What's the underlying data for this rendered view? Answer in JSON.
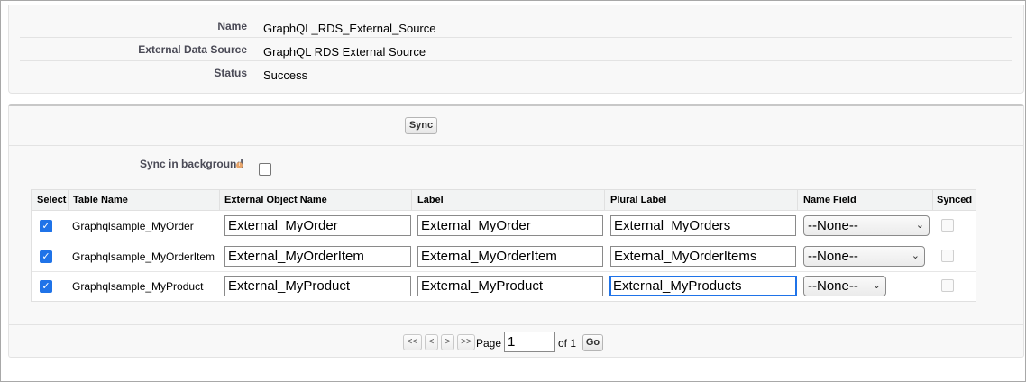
{
  "details": {
    "rows": [
      {
        "label": "Name",
        "value": "GraphQL_RDS_External_Source"
      },
      {
        "label": "External Data Source",
        "value": "GraphQL RDS External Source"
      },
      {
        "label": "Status",
        "value": "Success"
      }
    ]
  },
  "sync": {
    "button_label": "Sync",
    "background_label": "Sync in background",
    "background_checked": false,
    "help_icon": "info-icon"
  },
  "table": {
    "columns": [
      "Select",
      "Table Name",
      "External Object Name",
      "Label",
      "Plural Label",
      "Name Field",
      "Synced"
    ],
    "rows": [
      {
        "selected": true,
        "table_name": "Graphqlsample_MyOrder",
        "external_object_name": "External_MyOrder",
        "label": "External_MyOrder",
        "plural_label": "External_MyOrders",
        "name_field": "--None--",
        "synced": false
      },
      {
        "selected": true,
        "table_name": "Graphqlsample_MyOrderItem",
        "external_object_name": "External_MyOrderItem",
        "label": "External_MyOrderItem",
        "plural_label": "External_MyOrderItems",
        "name_field": "--None--",
        "synced": false
      },
      {
        "selected": true,
        "table_name": "Graphqlsample_MyProduct",
        "external_object_name": "External_MyProduct",
        "label": "External_MyProduct",
        "plural_label": "External_MyProducts",
        "name_field": "--None--",
        "synced": false
      }
    ]
  },
  "pagination": {
    "first": "<<",
    "prev": "<",
    "next": ">",
    "last": ">>",
    "page_label": "Page",
    "page_value": "1",
    "of_label": "of 1",
    "go_label": "Go"
  },
  "colors": {
    "checkbox_checked": "#1f73e8",
    "focus_border": "#1f73e8",
    "label_text": "#4a4a56"
  }
}
